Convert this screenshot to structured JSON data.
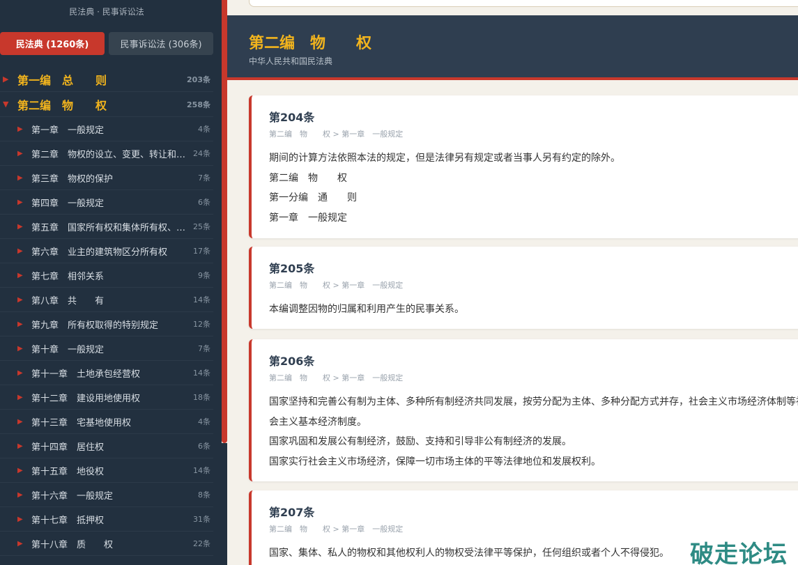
{
  "sidebar": {
    "subtitle": "民法典 · 民事诉讼法",
    "tabs": [
      {
        "label": "民法典 (1260条)",
        "active": true
      },
      {
        "label": "民事诉讼法 (306条)",
        "active": false
      }
    ],
    "parts": [
      {
        "name": "第一编　总　　则",
        "count": "203条",
        "expanded": false,
        "arrow": "▶"
      },
      {
        "name": "第二编　物　　权",
        "count": "258条",
        "expanded": true,
        "arrow": "▼"
      }
    ],
    "chapters": [
      {
        "name": "第一章　一般规定",
        "count": "4条"
      },
      {
        "name": "第二章　物权的设立、变更、转让和消灭",
        "count": "24条"
      },
      {
        "name": "第三章　物权的保护",
        "count": "7条"
      },
      {
        "name": "第四章　一般规定",
        "count": "6条"
      },
      {
        "name": "第五章　国家所有权和集体所有权、私人所有权",
        "count": "25条"
      },
      {
        "name": "第六章　业主的建筑物区分所有权",
        "count": "17条"
      },
      {
        "name": "第七章　相邻关系",
        "count": "9条"
      },
      {
        "name": "第八章　共　　有",
        "count": "14条"
      },
      {
        "name": "第九章　所有权取得的特别规定",
        "count": "12条"
      },
      {
        "name": "第十章　一般规定",
        "count": "7条"
      },
      {
        "name": "第十一章　土地承包经营权",
        "count": "14条"
      },
      {
        "name": "第十二章　建设用地使用权",
        "count": "18条"
      },
      {
        "name": "第十三章　宅基地使用权",
        "count": "4条"
      },
      {
        "name": "第十四章　居住权",
        "count": "6条"
      },
      {
        "name": "第十五章　地役权",
        "count": "14条"
      },
      {
        "name": "第十六章　一般规定",
        "count": "8条"
      },
      {
        "name": "第十七章　抵押权",
        "count": "31条"
      },
      {
        "name": "第十八章　质　　权",
        "count": "22条"
      }
    ],
    "chapter_arrow": "▶"
  },
  "header": {
    "title": "第二编　物　　权",
    "subtitle": "中华人民共和国民法典"
  },
  "articles": [
    {
      "title": "第204条",
      "crumb": "第二编　物　　权 > 第一章　一般规定",
      "paragraphs": [
        "期间的计算方法依照本法的规定，但是法律另有规定或者当事人另有约定的除外。",
        "第二编　物　　权",
        "第一分编　通　　则",
        "第一章　一般规定"
      ]
    },
    {
      "title": "第205条",
      "crumb": "第二编　物　　权 > 第一章　一般规定",
      "paragraphs": [
        "本编调整因物的归属和利用产生的民事关系。"
      ]
    },
    {
      "title": "第206条",
      "crumb": "第二编　物　　权 > 第一章　一般规定",
      "paragraphs": [
        "国家坚持和完善公有制为主体、多种所有制经济共同发展，按劳分配为主体、多种分配方式并存，社会主义市场经济体制等社会主义基本经济制度。",
        "国家巩固和发展公有制经济，鼓励、支持和引导非公有制经济的发展。",
        "国家实行社会主义市场经济，保障一切市场主体的平等法律地位和发展权利。"
      ]
    },
    {
      "title": "第207条",
      "crumb": "第二编　物　　权 > 第一章　一般规定",
      "paragraphs": [
        "国家、集体、私人的物权和其他权利人的物权受法律平等保护，任何组织或者个人不得侵犯。"
      ]
    }
  ],
  "watermark": "破走论坛",
  "colors": {
    "accent": "#c8382c",
    "gold": "#f2b41d",
    "sidebar_bg": "#22303f",
    "header_bg": "#2f3e50"
  }
}
